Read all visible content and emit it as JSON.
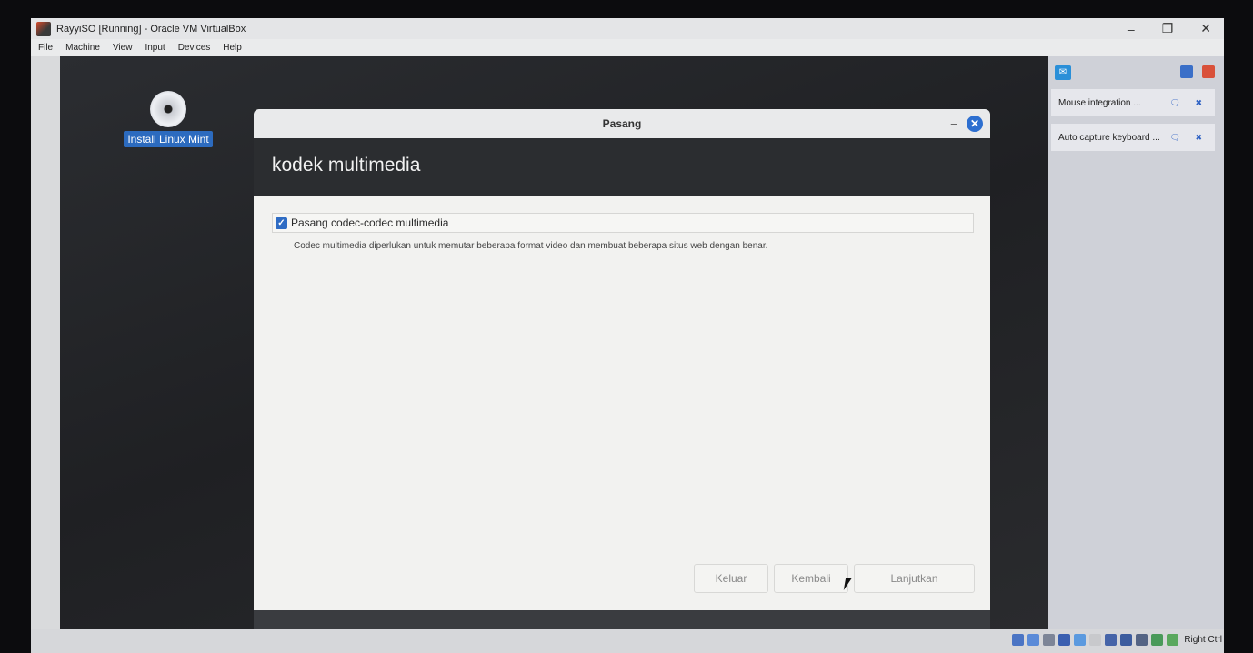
{
  "window": {
    "title": "RayyiSO [Running] - Oracle VM VirtualBox",
    "minimize": "–",
    "restore": "❐",
    "close": "✕"
  },
  "menu": [
    "File",
    "Machine",
    "View",
    "Input",
    "Devices",
    "Help"
  ],
  "desktop": {
    "icon_label": "Install Linux Mint"
  },
  "dialog": {
    "title": "Pasang",
    "minimize": "–",
    "close": "✕",
    "heading": "kodek multimedia",
    "checkbox_label": "Pasang codec-codec multimedia",
    "checkbox_checked": true,
    "checkmark": "✓",
    "description": "Codec multimedia diperlukan untuk memutar beberapa format video dan membuat beberapa situs web dengan benar.",
    "buttons": {
      "quit": "Keluar",
      "back": "Kembali",
      "continue": "Lanjutkan"
    }
  },
  "side_panel": {
    "message_icon": "message-icon",
    "notices": [
      {
        "text": "Mouse integration ..."
      },
      {
        "text": "Auto capture keyboard ..."
      }
    ]
  },
  "status_bar": {
    "host_key": "Right Ctrl"
  },
  "colors": {
    "accent": "#2f6cc4",
    "guest_bg": "#25272b",
    "dialog_body": "#f2f2f0"
  }
}
